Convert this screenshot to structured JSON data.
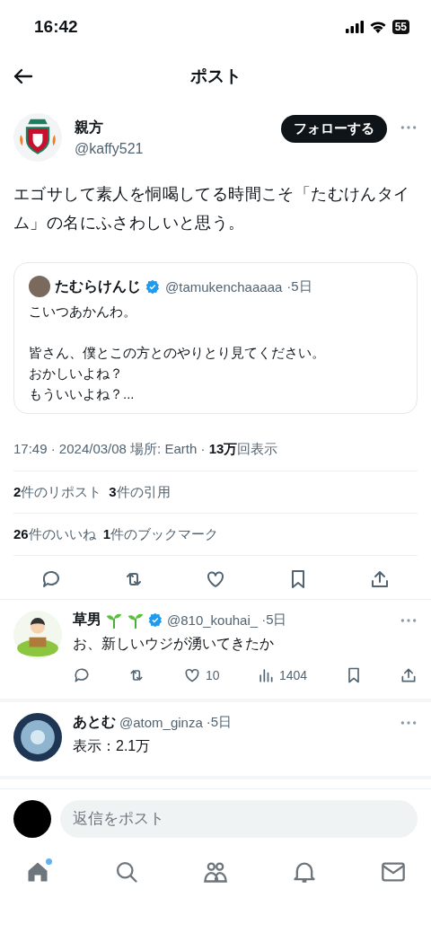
{
  "status_bar": {
    "time": "16:42",
    "battery": "55"
  },
  "header": {
    "title": "ポスト"
  },
  "post": {
    "author": {
      "name": "親方",
      "handle": "@kaffy521"
    },
    "follow_button": "フォローする",
    "text": "エゴサして素人を恫喝してる時間こそ「たむけんタイム」の名にふさわしいと思う。",
    "quote": {
      "name": "たむらけんじ",
      "verified": true,
      "handle": "@tamukenchaaaaa",
      "time": "·5日",
      "paragraphs": [
        [
          "こいつあかんわ。"
        ],
        [
          "皆さん、僕とこの方とのやりとり見てください。",
          "おかしいよね？",
          "もういいよね？..."
        ]
      ]
    },
    "meta": "17:49 · 2024/03/08 場所: Earth · **13万**回表示",
    "stats": [
      [
        "**2**件のリポスト",
        "**3**件の引用"
      ],
      [
        "**26**件のいいね",
        "**1**件のブックマーク"
      ]
    ],
    "actions": [
      {
        "kind": "reply"
      },
      {
        "kind": "repost"
      },
      {
        "kind": "like"
      },
      {
        "kind": "bookmark"
      },
      {
        "kind": "share"
      }
    ]
  },
  "replies": [
    {
      "name": "草男",
      "name_icons": [
        {
          "kind": "sprout"
        },
        {
          "kind": "sprout"
        }
      ],
      "verified": true,
      "handle": "@810_kouhai_",
      "time": "·5日",
      "avatar": {
        "kind": "illustration"
      },
      "text": "お、新しいウジが湧いてきたか",
      "actions": [
        {
          "kind": "reply"
        },
        {
          "kind": "repost"
        },
        {
          "kind": "like",
          "count": "10"
        },
        {
          "kind": "views",
          "count": "1404"
        },
        {
          "kind": "bookmark"
        },
        {
          "kind": "share"
        }
      ]
    },
    {
      "name": "あとむ",
      "verified": false,
      "handle": "@atom_ginza",
      "time": "·5日",
      "avatar": {
        "kind": "disc"
      },
      "text": "表示：2.1万"
    }
  ],
  "compose": {
    "placeholder": "返信をポスト"
  },
  "tab_bar": [
    {
      "kind": "home",
      "selected": true,
      "dot": true
    },
    {
      "kind": "search",
      "selected": false,
      "dot": false
    },
    {
      "kind": "communities",
      "selected": false,
      "dot": false
    },
    {
      "kind": "notifications",
      "selected": false,
      "dot": false
    },
    {
      "kind": "messages",
      "selected": false,
      "dot": false
    }
  ]
}
